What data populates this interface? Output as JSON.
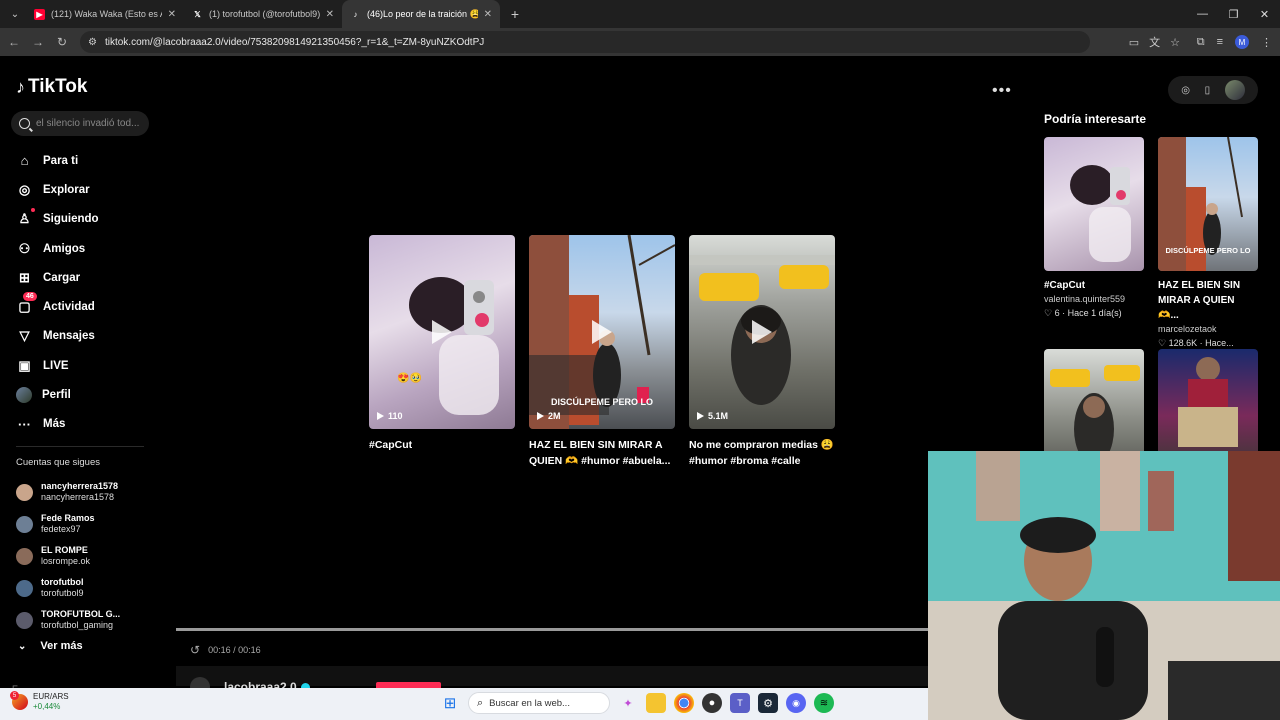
{
  "browser": {
    "tabs": [
      {
        "title": "(121) Waka Waka (Esto es Afric",
        "favicon": "youtube-icon",
        "color": "#ff0033"
      },
      {
        "title": "(1) torofutbol (@torofutbol9) /",
        "favicon": "x-icon",
        "color": "#ffffff"
      },
      {
        "title": "(46)Lo peor de la traición 😩 #",
        "favicon": "tiktok-icon",
        "color": "#ffffff"
      }
    ],
    "url": "tiktok.com/@lacobraaa2.0/video/7538209814921350456?_r=1&_t=ZM-8yuNZKOdtPJ",
    "profile_initial": "M"
  },
  "tiktok": {
    "logo": "TikTok",
    "search_placeholder": "el silencio invadió tod...",
    "nav": [
      {
        "label": "Para ti",
        "icon": "home-icon"
      },
      {
        "label": "Explorar",
        "icon": "compass-icon"
      },
      {
        "label": "Siguiendo",
        "icon": "following-icon"
      },
      {
        "label": "Amigos",
        "icon": "friends-icon"
      },
      {
        "label": "Cargar",
        "icon": "upload-icon"
      },
      {
        "label": "Actividad",
        "icon": "activity-icon",
        "badge": "46"
      },
      {
        "label": "Mensajes",
        "icon": "messages-icon"
      },
      {
        "label": "LIVE",
        "icon": "live-icon"
      },
      {
        "label": "Perfil",
        "icon": "profile-avatar"
      },
      {
        "label": "Más",
        "icon": "more-icon"
      }
    ],
    "following_title": "Cuentas que sigues",
    "following": [
      {
        "name": "nancyherrera1578",
        "handle": "nancyherrera1578",
        "color": "#c9a58b"
      },
      {
        "name": "Fede Ramos",
        "handle": "fedetex97",
        "color": "#6d7f95"
      },
      {
        "name": "EL ROMPE",
        "handle": "losrompe.ok",
        "color": "#8a6b5a"
      },
      {
        "name": "torofutbol",
        "handle": "torofutbol9",
        "color": "#4d6a8a"
      },
      {
        "name": "TOROFUTBOL G...",
        "handle": "torofutbol_gaming",
        "color": "#5b5b6b"
      }
    ],
    "see_more": "Ver más",
    "footer_cut": "E"
  },
  "player": {
    "related": [
      {
        "title": "#CapCut",
        "views": "110",
        "caption": "",
        "emoji": "😍🥹"
      },
      {
        "title": "HAZ EL BIEN SIN MIRAR A QUIEN 🫶 #humor #abuela...",
        "views": "2M",
        "caption": "DISCÚLPEME PERO LO",
        "emoji": ""
      },
      {
        "title": "No me compraron medias 😩 #humor #broma #calle",
        "views": "5.1M",
        "caption": "",
        "emoji": ""
      }
    ],
    "time": "00:16 / 00:16",
    "author": "lacobraaa2.0",
    "progress": 1.0
  },
  "suggestions": {
    "title": "Podría interesarte",
    "items": [
      {
        "title": "#CapCut",
        "user": "valentina.quinter559",
        "meta": "♡ 6 · Hace 1 día(s)"
      },
      {
        "title": "HAZ EL BIEN SIN MIRAR A QUIEN 🫶...",
        "user": "marcelozetaok",
        "meta": "♡ 128.6K · Hace..."
      },
      {
        "title": "",
        "user": "",
        "meta": ""
      },
      {
        "title": "",
        "user": "",
        "meta": ""
      }
    ],
    "caption2": "DISCÚLPEME PERO LO"
  },
  "taskbar": {
    "ticker_label": "EUR/ARS",
    "ticker_change": "+0,44%",
    "search_placeholder": "Buscar en la web...",
    "weather_badge": "5"
  }
}
